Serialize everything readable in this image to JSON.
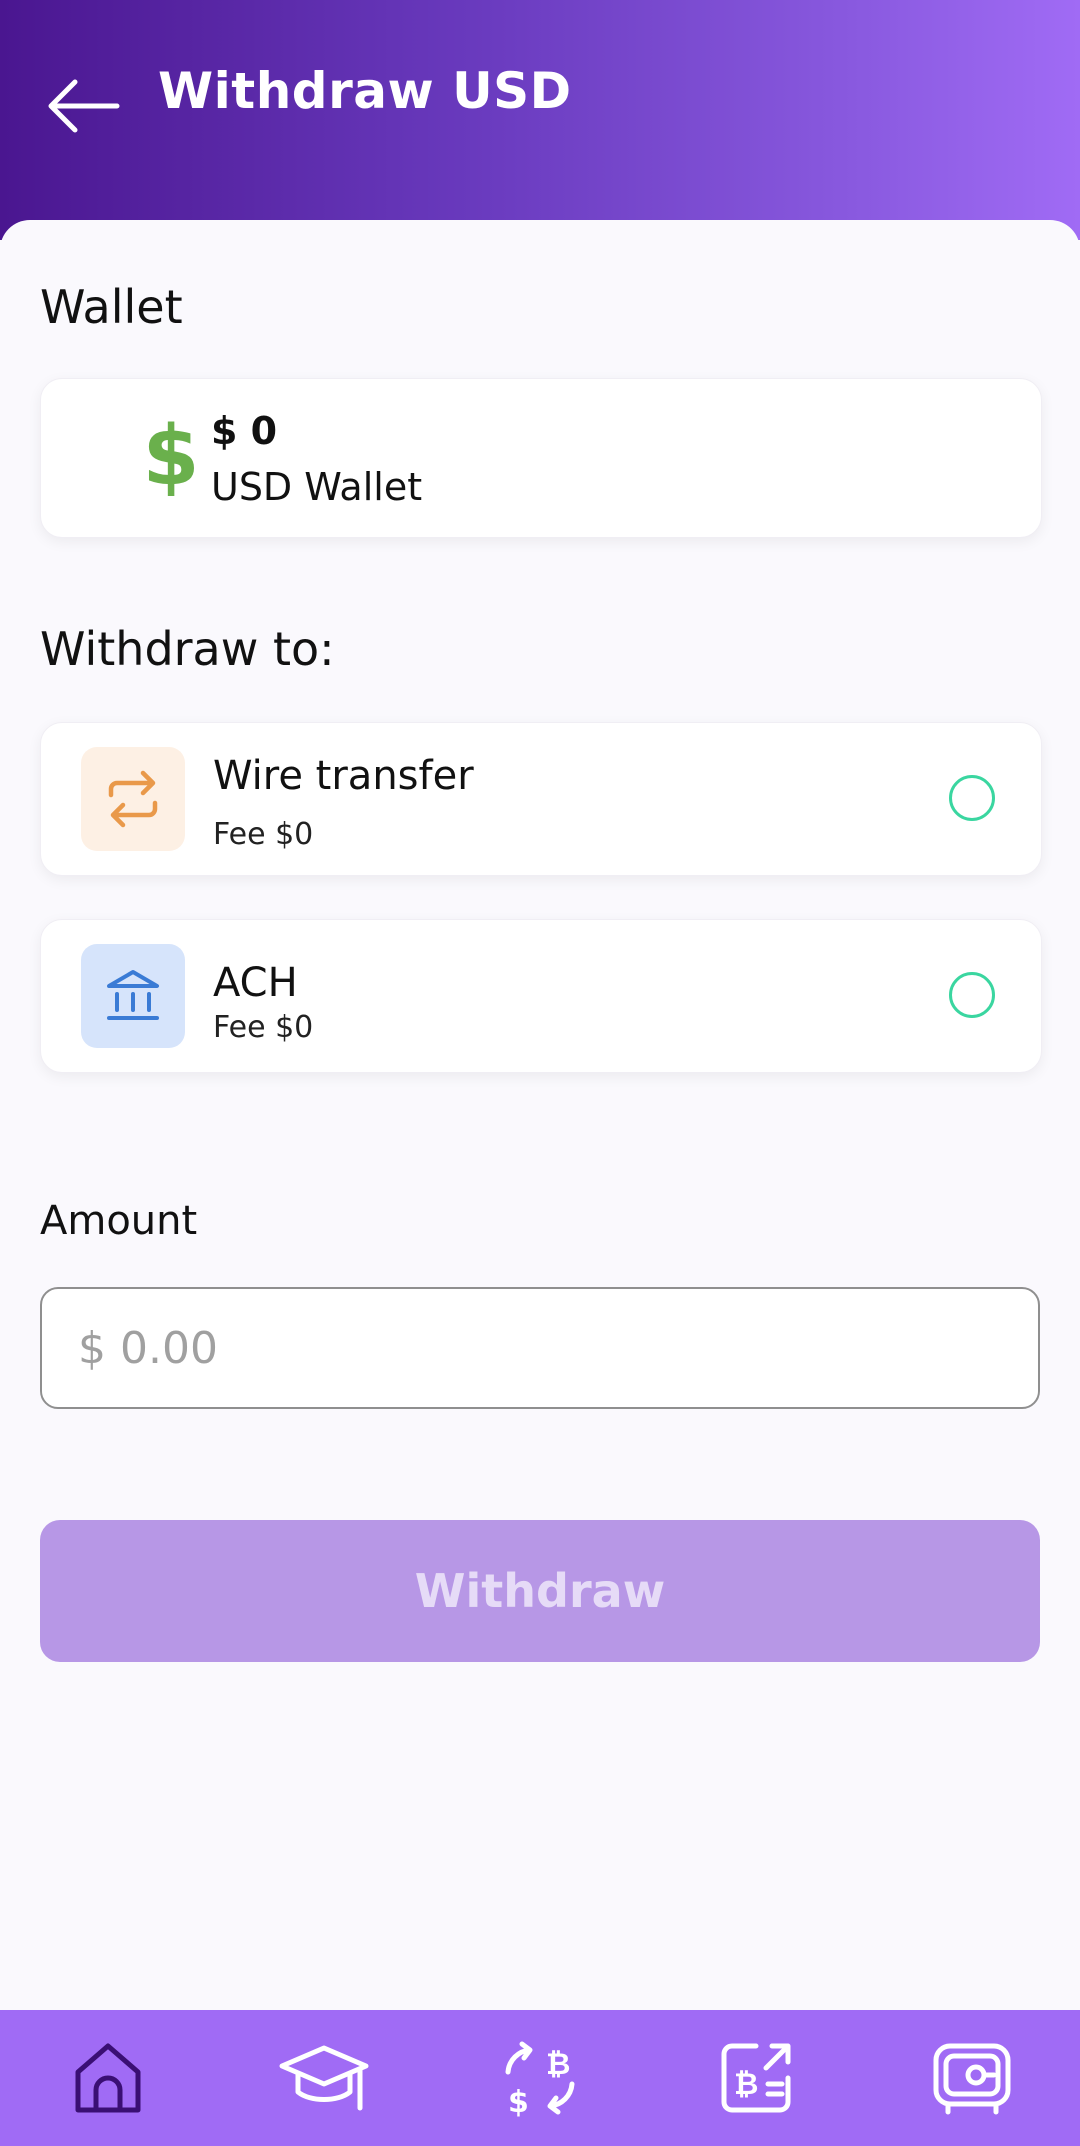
{
  "header": {
    "title": "Withdraw USD",
    "back_icon": "arrow-left-icon"
  },
  "wallet": {
    "section_label": "Wallet",
    "amount": "$ 0",
    "name": "USD Wallet",
    "icon_symbol": "$",
    "icon_color": "#6ab04c"
  },
  "withdraw_to": {
    "section_label": "Withdraw to:",
    "options": [
      {
        "title": "Wire transfer",
        "fee": "Fee $0",
        "icon": "transfer-arrows-icon",
        "icon_bg": "#fdf0e4",
        "icon_color": "#e9994a"
      },
      {
        "title": "ACH",
        "fee": "Fee $0",
        "icon": "bank-icon",
        "icon_bg": "#d6e4fb",
        "icon_color": "#3a7bd5"
      }
    ]
  },
  "amount": {
    "label": "Amount",
    "placeholder": "$ 0.00",
    "value": ""
  },
  "actions": {
    "withdraw_label": "Withdraw"
  },
  "colors": {
    "accent": "#a06bf5",
    "radio": "#3ad6a0",
    "button_disabled": "#b797e6"
  },
  "bottom_nav": {
    "items": [
      {
        "icon": "home-icon"
      },
      {
        "icon": "graduation-cap-icon"
      },
      {
        "icon": "crypto-exchange-icon"
      },
      {
        "icon": "bitcoin-send-icon"
      },
      {
        "icon": "vault-icon"
      }
    ]
  }
}
